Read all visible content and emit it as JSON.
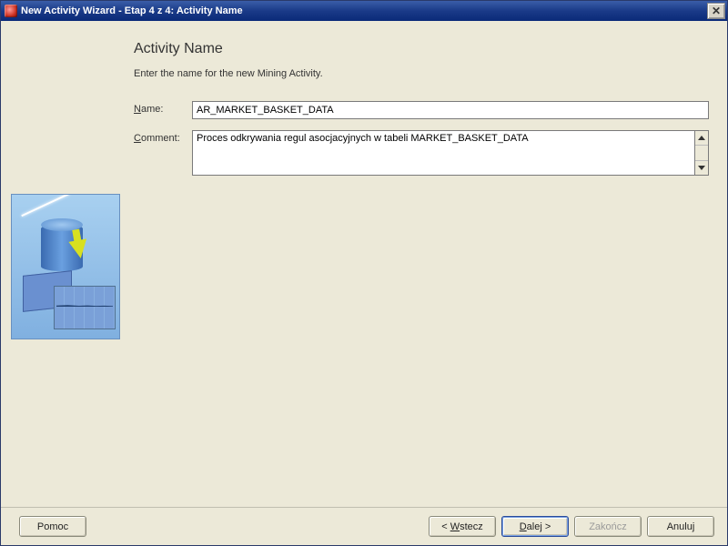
{
  "window": {
    "title": "New Activity Wizard - Etap 4 z 4: Activity Name"
  },
  "page": {
    "heading": "Activity Name",
    "instruction": "Enter the name for the new Mining Activity."
  },
  "form": {
    "name_label_pre": "",
    "name_label_u": "N",
    "name_label_post": "ame:",
    "name_value": "AR_MARKET_BASKET_DATA",
    "comment_label_pre": "",
    "comment_label_u": "C",
    "comment_label_post": "omment:",
    "comment_value": "Proces odkrywania regul asocjacyjnych w tabeli MARKET_BASKET_DATA"
  },
  "buttons": {
    "help": "Pomoc",
    "back_pre": "< ",
    "back_u": "W",
    "back_post": "stecz",
    "next_pre": "",
    "next_u": "D",
    "next_post": "alej >",
    "finish": "Zakończ",
    "cancel": "Anuluj"
  }
}
